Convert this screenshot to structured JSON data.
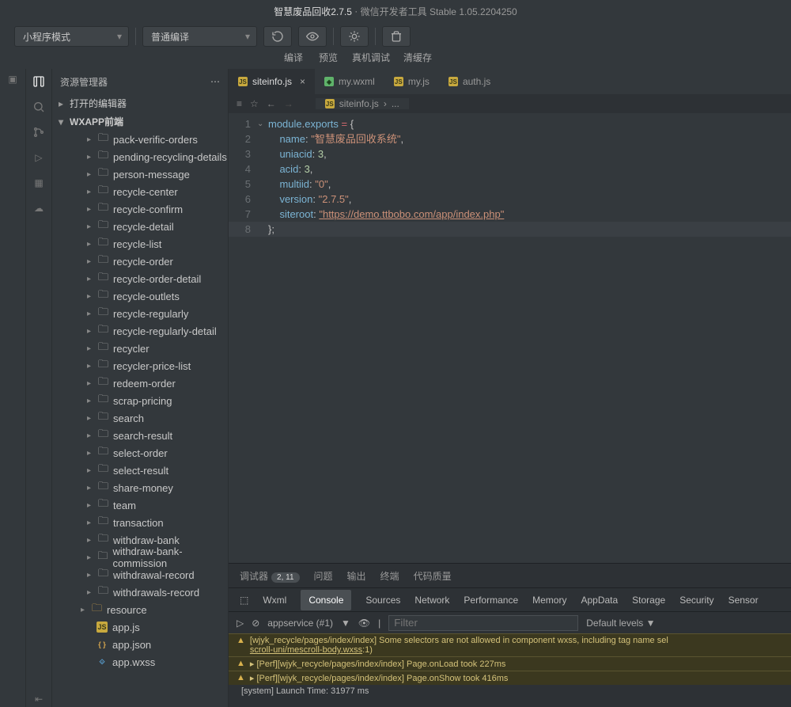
{
  "title": {
    "app": "智慧废品回收2.7.5",
    "tool": "微信开发者工具 Stable 1.05.2204250"
  },
  "top": {
    "mode": "小程序模式",
    "compile": "普通编译",
    "labels": {
      "compile_btn": "编译",
      "preview": "预览",
      "remote": "真机调试",
      "cache": "清缓存"
    }
  },
  "sidebar": {
    "title": "资源管理器",
    "sections": {
      "open_editors": "打开的编辑器",
      "project": "WXAPP前端"
    },
    "folders": [
      "pack-verific-orders",
      "pending-recycling-details",
      "person-message",
      "recycle-center",
      "recycle-confirm",
      "recycle-detail",
      "recycle-list",
      "recycle-order",
      "recycle-order-detail",
      "recycle-outlets",
      "recycle-regularly",
      "recycle-regularly-detail",
      "recycler",
      "recycler-price-list",
      "redeem-order",
      "scrap-pricing",
      "search",
      "search-result",
      "select-order",
      "select-result",
      "share-money",
      "team",
      "transaction",
      "withdraw-bank",
      "withdraw-bank-commission",
      "withdrawal-record",
      "withdrawals-record"
    ],
    "resource": "resource",
    "files": {
      "appjs": "app.js",
      "appjson": "app.json",
      "appwxss": "app.wxss"
    }
  },
  "tabs": [
    {
      "name": "siteinfo.js",
      "type": "js",
      "active": true
    },
    {
      "name": "my.wxml",
      "type": "wxml",
      "active": false
    },
    {
      "name": "my.js",
      "type": "js",
      "active": false
    },
    {
      "name": "auth.js",
      "type": "js",
      "active": false
    }
  ],
  "breadcrumb": {
    "file": "siteinfo.js",
    "rest": "..."
  },
  "code": {
    "name_val": "\"智慧废品回收系统\"",
    "uniacid": "3",
    "acid": "3",
    "multiid": "\"0\"",
    "version": "\"2.7.5\"",
    "siteroot": "\"https://demo.ttbobo.com/app/index.php\""
  },
  "panel": {
    "tabs": {
      "debugger": "调试器",
      "count": "2, 11",
      "issues": "问题",
      "output": "输出",
      "terminal": "终端",
      "quality": "代码质量"
    },
    "dev": [
      "Wxml",
      "Console",
      "Sources",
      "Network",
      "Performance",
      "Memory",
      "AppData",
      "Storage",
      "Security",
      "Sensor"
    ],
    "dev_active": "Console",
    "scope": "appservice (#1)",
    "filter_placeholder": "Filter",
    "levels": "Default levels ▼",
    "rows": [
      {
        "t": "warn",
        "text": "[wjyk_recycle/pages/index/index] Some selectors are not allowed in component wxss, including tag name sel",
        "sub": "scroll-uni/mescroll-body.wxss:1:1)"
      },
      {
        "t": "warn",
        "text": "▸ [Perf][wjyk_recycle/pages/index/index] Page.onLoad took 227ms"
      },
      {
        "t": "warn",
        "text": "▸ [Perf][wjyk_recycle/pages/index/index] Page.onShow took 416ms"
      },
      {
        "t": "sys",
        "text": "[system] Launch Time: 31977 ms"
      }
    ]
  }
}
